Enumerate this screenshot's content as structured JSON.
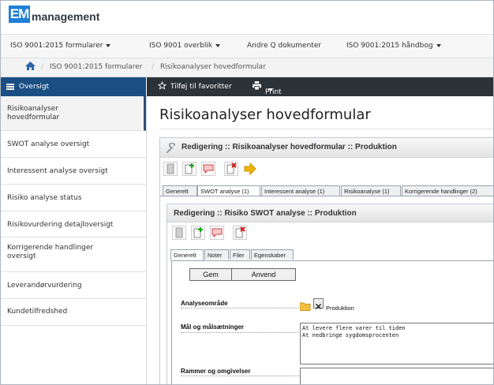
{
  "brand": {
    "logo_mark": "EM",
    "logo_text": "management"
  },
  "menu": [
    {
      "label": "ISO 9001:2015 formularer",
      "dropdown": true
    },
    {
      "label": "ISO 9001 overblik",
      "dropdown": true
    },
    {
      "label": "Andre Q dokumenter",
      "dropdown": false
    },
    {
      "label": "ISO 9001:2015 håndbog",
      "dropdown": true
    }
  ],
  "breadcrumb": {
    "home_icon": "home-icon",
    "sep": "/",
    "items": [
      "ISO 9001:2015 formularer",
      "Risikoanalyser hovedformular"
    ]
  },
  "sidebar": {
    "header_label": "Oversigt",
    "items": [
      {
        "label": "Risikoanalyser\nhovedformular",
        "active": true
      },
      {
        "label": "SWOT analyse oversigt"
      },
      {
        "label": "Interessent analyse oversigt"
      },
      {
        "label": "Risiko analyse status"
      },
      {
        "label": "Risikovurdering detajloversigt"
      },
      {
        "label": "Korrigerende handlinger\noversigt"
      },
      {
        "label": "Leverandørvurdering"
      },
      {
        "label": "Kundetilfredshed"
      }
    ]
  },
  "toolbar": {
    "favorites_label": "Tilføj til favoritter",
    "print_label": "Print"
  },
  "page_title": "Risikoanalyser hovedformular",
  "outer_panel": {
    "title": "Redigering :: Risikoanalyser hovedformular :: Produktion",
    "tabs": [
      "Generelt",
      "SWOT analyse (1)",
      "Interessent analyse (1)",
      "Risikoanalyse (1)",
      "Korrigerende handlinger (2)"
    ],
    "active_tab": 1
  },
  "inner_panel": {
    "title": "Redigering :: Risiko SWOT analyse :: Produktion",
    "tabs": [
      "Generelt",
      "Noter",
      "Filer",
      "Egenskaber"
    ],
    "active_tab": 0
  },
  "form": {
    "save_label": "Gem",
    "apply_label": "Anvend",
    "fields": {
      "area_label": "Analyseområde",
      "area_value": "Produktion",
      "goals_label": "Mål og målsætninger",
      "goals_value": "At levere flere varer til tiden\nAt nedbringe sygdomsprocenten",
      "framework_label": "Rammer og omgivelser",
      "framework_value": ""
    }
  },
  "colors": {
    "brand_blue": "#1f7fd6",
    "sidebar_header": "#1b4f84",
    "toolbar_bg": "#2b3238"
  }
}
